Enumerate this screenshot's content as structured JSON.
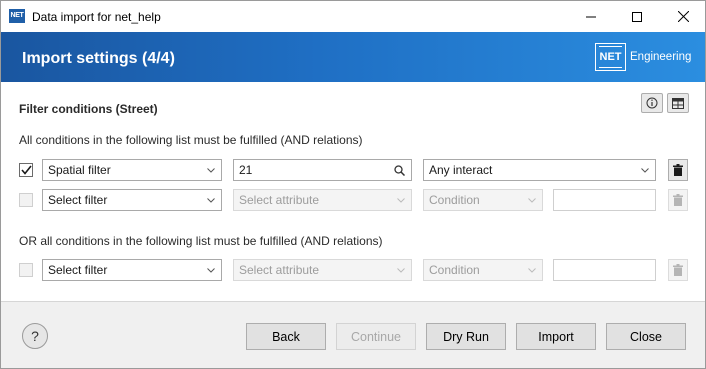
{
  "window": {
    "title": "Data import for net_help",
    "app_icon_text": "NET",
    "controls": [
      "minimize",
      "maximize",
      "close"
    ]
  },
  "banner": {
    "title": "Import settings (4/4)",
    "logo_box": "NET",
    "logo_text": "Engineering",
    "colors": {
      "start": "#1a56a0",
      "end": "#2b8ee0"
    }
  },
  "section": {
    "title": "Filter conditions (Street)",
    "info_icon": "info-icon",
    "table_icon": "table-icon"
  },
  "and_group": {
    "label": "All conditions in the following list must be fulfilled (AND relations)",
    "rows": [
      {
        "checked": true,
        "filter": "Spatial filter",
        "attribute": "21",
        "attribute_kind": "search",
        "condition": "Any interact",
        "value": "",
        "enabled": true
      },
      {
        "checked": false,
        "filter": "Select filter",
        "attribute": "Select attribute",
        "attribute_kind": "select",
        "condition": "Condition",
        "value": "",
        "enabled": false
      }
    ]
  },
  "or_group": {
    "label": "OR all conditions in the following list must be fulfilled (AND relations)",
    "rows": [
      {
        "checked": false,
        "filter": "Select filter",
        "attribute": "Select attribute",
        "attribute_kind": "select",
        "condition": "Condition",
        "value": "",
        "enabled": false
      }
    ]
  },
  "footer": {
    "help_label": "?",
    "buttons": {
      "back": "Back",
      "continue": "Continue",
      "dry_run": "Dry Run",
      "import": "Import",
      "close": "Close"
    }
  }
}
